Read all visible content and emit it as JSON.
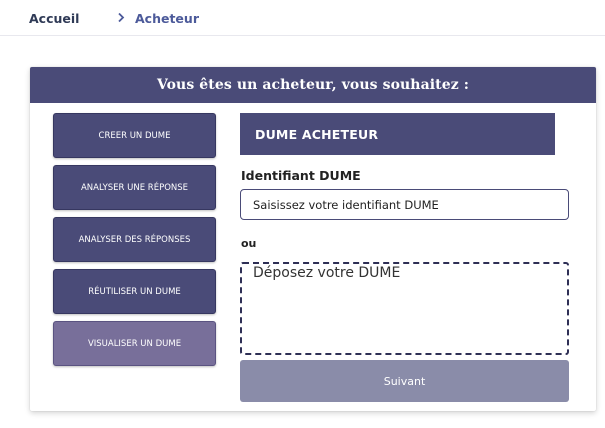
{
  "breadcrumb": {
    "home": "Accueil",
    "separator_icon": "chevron-right-icon",
    "current": "Acheteur"
  },
  "card": {
    "title": "Vous êtes un acheteur, vous souhaitez :"
  },
  "actions": [
    {
      "label": "CREER UN DUME",
      "active": false
    },
    {
      "label": "ANALYSER UNE RÉPONSE",
      "active": false
    },
    {
      "label": "ANALYSER DES RÉPONSES",
      "active": false
    },
    {
      "label": "RÉUTILISER UN DUME",
      "active": false
    },
    {
      "label": "VISUALISER UN DUME",
      "active": true
    }
  ],
  "panel": {
    "title": "DUME ACHETEUR",
    "id_label": "Identifiant DUME",
    "id_value": "",
    "id_placeholder": "Saisissez votre identifiant DUME",
    "or_label": "ou",
    "dropzone_text": "Déposez votre DUME",
    "next_label": "Suivant"
  },
  "colors": {
    "primary": "#4a4b78",
    "active_action": "#786f9a",
    "disabled_button": "#8a8ca9",
    "breadcrumb_current": "#4c5a9a"
  }
}
